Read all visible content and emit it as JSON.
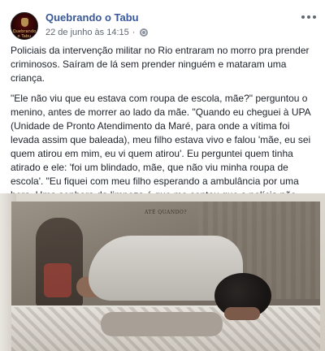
{
  "post": {
    "page_name": "Quebrando o Tabu",
    "avatar_label": "Quebrando o Tabu",
    "timestamp": "22 de junho às 14:15",
    "separator": "·",
    "privacy_icon": "globe-icon",
    "options_icon": "more-options-icon",
    "paragraphs": [
      "Policiais da intervenção militar no Rio entraram no morro pra prender criminosos. Saíram de lá sem prender ninguém e mataram uma criança.",
      "\"Ele não viu que eu estava com roupa de escola, mãe?\" perguntou o menino, antes de morrer ao lado da mãe. \"Quando eu cheguei à UPA (Unidade de Pronto Atendimento da Maré, para onde a vítima foi levada assim que baleada), meu filho estava vivo e falou 'mãe, eu sei quem atirou em mim, eu vi quem atirou'. Eu perguntei quem tinha atirado e ele: 'foi um blindado, mãe, que não viu minha roupa de escola'. \"Eu fiquei com meu filho esperando a ambulância por uma hora. Uma senhora da limpeza é que me contou que a polícia não tinha deixado a ambulância entrar (na favela). Depois houve uma ordem superior e a ambulância entrou, mas ele já estava roxo, estava morrendo na minha frente\""
    ],
    "photo_caption": "ATÉ QUANDO?"
  },
  "colors": {
    "link": "#385898",
    "text": "#1d2129",
    "meta": "#606770"
  }
}
